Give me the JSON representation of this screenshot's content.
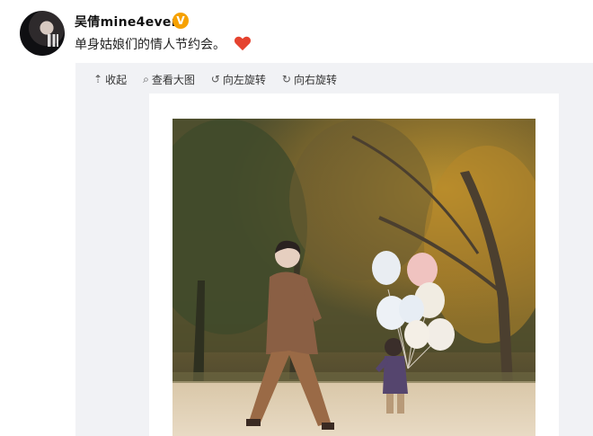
{
  "post": {
    "username": "吴倩mine4ever",
    "verified_badge": "V",
    "text": "单身姑娘们的情人节约会。",
    "emoji_icon": "heart-icon"
  },
  "toolbar": {
    "collapse": "收起",
    "view_large": "查看大图",
    "rotate_left": "向左旋转",
    "rotate_right": "向右旋转"
  },
  "colors": {
    "badge": "#f6a100",
    "heart": "#e5432f",
    "panel": "#f1f2f5"
  }
}
